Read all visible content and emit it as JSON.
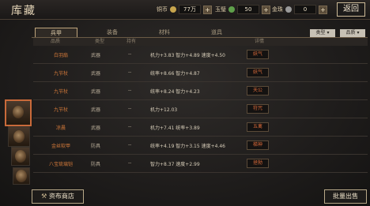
{
  "header": {
    "title": "库藏",
    "resources": [
      {
        "label": "铜币",
        "value": "77万",
        "color": "#c7a54d"
      },
      {
        "label": "玉璧",
        "value": "50",
        "color": "#5fa04b"
      },
      {
        "label": "金珠",
        "value": "0",
        "color": "#9a9a9a"
      }
    ],
    "plus": "+",
    "back_label": "返回"
  },
  "tabs": [
    "兵甲",
    "装备",
    "材料",
    "道具"
  ],
  "dropdowns": [
    "类型",
    "品质"
  ],
  "columns": [
    "品质",
    "类型",
    "持有",
    "详情"
  ],
  "rows": [
    {
      "name": "白羽扇",
      "type": "武器",
      "holder": "--",
      "detail": "机力+3.83 智力+4.89 速度+4.50",
      "tag": "妖气"
    },
    {
      "name": "九节杖",
      "type": "武器",
      "holder": "--",
      "detail": "统率+8.66 智力+4.87",
      "tag": "妖气"
    },
    {
      "name": "九节杖",
      "type": "武器",
      "holder": "--",
      "detail": "统率+8.24 智力+4.23",
      "tag": "天公"
    },
    {
      "name": "九节杖",
      "type": "武器",
      "holder": "--",
      "detail": "机力+12.03",
      "tag": "符咒"
    },
    {
      "name": "凉晨",
      "type": "武器",
      "holder": "--",
      "detail": "机力+7.41 统率+3.89",
      "tag": "五禽"
    },
    {
      "name": "金丝软甲",
      "type": "防具",
      "holder": "--",
      "detail": "统率+4.19 智力+3.15 速度+4.46",
      "tag": "梯神"
    },
    {
      "name": "八宝琉璃铠",
      "type": "防具",
      "holder": "--",
      "detail": "智力+8.37 速度+2.99",
      "tag": "拯勃"
    }
  ],
  "buttons": {
    "shop": "资布商店",
    "sell": "批量出售"
  }
}
